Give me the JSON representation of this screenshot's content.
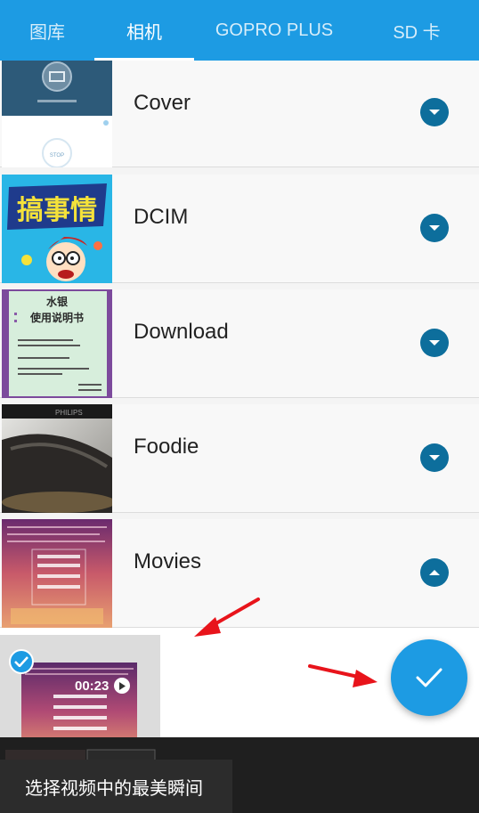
{
  "tabs": [
    {
      "label": "图库"
    },
    {
      "label": "相机"
    },
    {
      "label": "GOPRO PLUS"
    },
    {
      "label": "SD 卡"
    }
  ],
  "folders": [
    {
      "name": "Cover",
      "expanded": false
    },
    {
      "name": "DCIM",
      "expanded": false
    },
    {
      "name": "Download",
      "expanded": false
    },
    {
      "name": "Foodie",
      "expanded": false
    },
    {
      "name": "Movies",
      "expanded": true
    }
  ],
  "thumb_texts": {
    "dcim": "搞事情",
    "download_title": "水银",
    "download_subtitle": "使用说明书",
    "foodie_brand": "PHILIPS",
    "cover_text": "STOP"
  },
  "video": {
    "duration": "00:23",
    "selected": true
  },
  "toast": {
    "text": "选择视频中的最美瞬间"
  },
  "colors": {
    "primary": "#1d9be3",
    "chevron": "#0d6e9c",
    "annotation_arrow": "#e8141b"
  }
}
